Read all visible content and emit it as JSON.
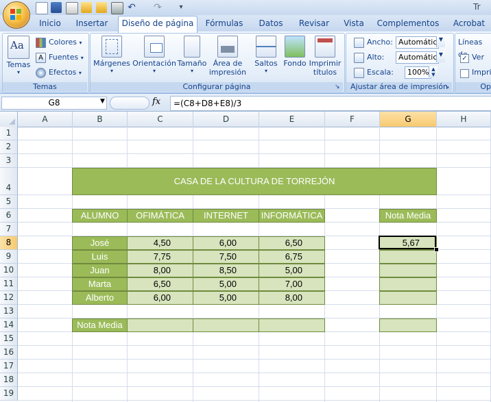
{
  "window": {
    "title_partial": "Tr"
  },
  "tabs": [
    "Inicio",
    "Insertar",
    "Diseño de página",
    "Fórmulas",
    "Datos",
    "Revisar",
    "Vista",
    "Complementos",
    "Acrobat"
  ],
  "ribbon": {
    "temas": {
      "label": "Temas",
      "btn_temas": "Temas",
      "colores": "Colores",
      "fuentes": "Fuentes",
      "efectos": "Efectos"
    },
    "configurar": {
      "label": "Configurar página",
      "margenes": "Márgenes",
      "orientacion": "Orientación",
      "tamano": "Tamaño",
      "area_line1": "Área de",
      "area_line2": "impresión",
      "saltos": "Saltos",
      "fondo": "Fondo",
      "imprimir_line1": "Imprimir",
      "imprimir_line2": "títulos"
    },
    "ajustar": {
      "label": "Ajustar área de impresión",
      "ancho_label": "Ancho:",
      "ancho_value": "Automático",
      "alto_label": "Alto:",
      "alto_value": "Automático",
      "escala_label": "Escala:",
      "escala_value": "100%"
    },
    "opciones": {
      "label": "Op",
      "lineas": "Líneas de",
      "ver": "Ver",
      "imprimir": "Impri"
    }
  },
  "formula_bar": {
    "name_box": "G8",
    "fx": "fx",
    "formula": "=(C8+D8+E8)/3"
  },
  "columns": [
    "A",
    "B",
    "C",
    "D",
    "E",
    "F",
    "G",
    "H"
  ],
  "selected_column": "G",
  "rows": [
    "1",
    "2",
    "3",
    "4",
    "5",
    "6",
    "7",
    "8",
    "9",
    "10",
    "11",
    "12",
    "13",
    "14",
    "15",
    "16",
    "17",
    "18",
    "19"
  ],
  "selected_row": "8",
  "sheet": {
    "title": "CASA DE LA CULTURA DE TORREJÓN",
    "headers": [
      "ALUMNO",
      "OFIMÁTICA",
      "INTERNET",
      "INFORMÁTICA"
    ],
    "nota_media_header": "Nota Media",
    "students": [
      {
        "name": "José",
        "ofimatica": "4,50",
        "internet": "6,00",
        "informatica": "6,50",
        "media": "5,67"
      },
      {
        "name": "Luis",
        "ofimatica": "7,75",
        "internet": "7,50",
        "informatica": "6,75",
        "media": ""
      },
      {
        "name": "Juan",
        "ofimatica": "8,00",
        "internet": "8,50",
        "informatica": "5,00",
        "media": ""
      },
      {
        "name": "Marta",
        "ofimatica": "6,50",
        "internet": "5,00",
        "informatica": "7,00",
        "media": ""
      },
      {
        "name": "Alberto",
        "ofimatica": "6,00",
        "internet": "5,00",
        "informatica": "8,00",
        "media": ""
      }
    ],
    "nota_media_row_label": "Nota Media"
  }
}
